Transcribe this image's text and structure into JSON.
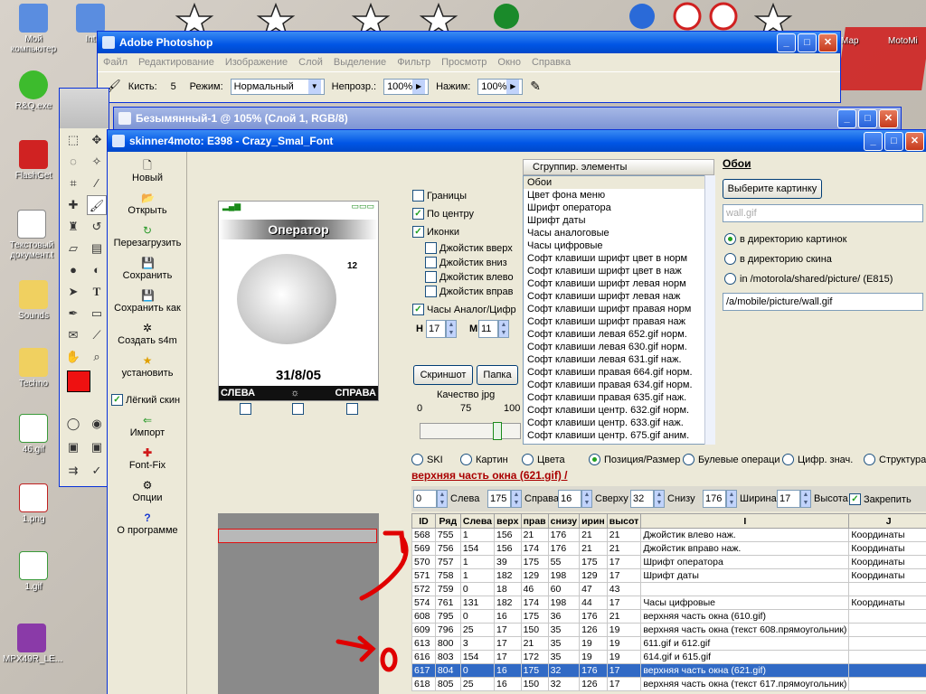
{
  "desktop": {
    "icons": [
      {
        "label": "Мой компьютер"
      },
      {
        "label": "R&Q.exe"
      },
      {
        "label": "FlashGet"
      },
      {
        "label": "Текстовый документ.t"
      },
      {
        "label": "Sounds"
      },
      {
        "label": "Techno"
      },
      {
        "label": "46.gif"
      },
      {
        "label": "1.png"
      },
      {
        "label": "1.gif"
      },
      {
        "label": "MPX49R_LE..."
      }
    ],
    "partial_labels": {
      "top_int": "Int",
      "right_mar": "Мар",
      "right_moto": "MotoMi"
    }
  },
  "photoshop": {
    "title": "Adobe Photoshop",
    "menu": [
      "Файл",
      "Редактирование",
      "Изображение",
      "Слой",
      "Выделение",
      "Фильтр",
      "Просмотр",
      "Окно",
      "Справка"
    ],
    "options": {
      "brush_label": "Кисть:",
      "brush_size": "5",
      "mode_label": "Режим:",
      "mode_value": "Нормальный",
      "opacity_label": "Непрозр.:",
      "opacity_value": "100%",
      "pressure_label": "Нажим:",
      "pressure_value": "100%"
    },
    "doc_title": "Безымянный-1 @ 105% (Слой 1, RGB/8)"
  },
  "skinner": {
    "title": "skinner4moto: E398 - Crazy_Smal_Font",
    "left_buttons": [
      {
        "label": "Новый"
      },
      {
        "label": "Открыть"
      },
      {
        "label": "Перезагрузить"
      },
      {
        "label": "Сохранить"
      },
      {
        "label": "Сохранить как"
      },
      {
        "label": "Создать s4m"
      },
      {
        "label": "установить"
      },
      {
        "label": "Лёгкий скин"
      },
      {
        "label": "Импорт"
      },
      {
        "label": "Font-Fix"
      },
      {
        "label": "Опции"
      },
      {
        "label": "О программе"
      }
    ],
    "phone": {
      "operator": "Оператор",
      "date": "31/8/05",
      "soft_left": "СЛЕВА",
      "soft_center": "☼",
      "soft_right": "СПРАВА",
      "clock_digits": "12"
    },
    "options": {
      "borders": "Границы",
      "center": "По центру",
      "icons": "Иконки",
      "joy_up": "Джойстик вверх",
      "joy_down": "Джойстик вниз",
      "joy_left": "Джойстик влево",
      "joy_right": "Джойстик вправ",
      "clock": "Часы Аналог/Цифр",
      "h_label": "Н",
      "h_value": "17",
      "m_label": "М",
      "m_value": "11",
      "screenshot": "Скриншот",
      "folder": "Папка",
      "jpg_quality": "Качество jpg",
      "q0": "0",
      "q75": "75",
      "q100": "100",
      "quality_value": 0.8
    },
    "group_title": "Сгруппир. элементы",
    "group_items": [
      "Обои",
      "Цвет фона меню",
      "Шрифт оператора",
      "Шрифт даты",
      "Часы аналоговые",
      "Часы цифровые",
      "Софт клавиши шрифт цвет в норм",
      "Софт клавиши шрифт цвет в наж",
      "Софт клавиши шрифт левая норм",
      "Софт клавиши шрифт левая наж",
      "Софт клавиши шрифт правая норм",
      "Софт клавиши шрифт правая наж",
      "Софт клавиши левая 652.gif норм.",
      "Софт клавиши левая 630.gif норм.",
      "Софт клавиши левая 631.gif наж.",
      "Софт клавиши правая 664.gif норм.",
      "Софт клавиши правая 634.gif норм.",
      "Софт клавиши правая 635.gif наж.",
      "Софт клавиши центр. 632.gif норм.",
      "Софт клавиши центр. 633.gif наж.",
      "Софт клавиши центр. 675.gif аним."
    ],
    "wallpaper": {
      "title": "Обои",
      "choose": "Выберите картинку",
      "file": "wall.gif",
      "r1": "в директорию картинок",
      "r2": "в директорию скина",
      "r3": "in /motorola/shared/picture/ (E815)",
      "path": "/a/mobile/picture/wall.gif"
    },
    "tabs": [
      "SKI",
      "Картин",
      "Цвета",
      "Позиция/Размер",
      "Булевые операци",
      "Цифр. знач.",
      "Структура"
    ],
    "section_title": "верхняя часть окна (621.gif) /",
    "pos": {
      "left_v": "0",
      "left_l": "Слева",
      "right_v": "175",
      "right_l": "Справа",
      "top_v": "16",
      "top_l": "Сверху",
      "bottom_v": "32",
      "bottom_l": "Снизу",
      "width_v": "176",
      "width_l": "Ширина",
      "height_v": "17",
      "height_l": "Высота",
      "lock": "Закрепить"
    },
    "table": {
      "headers": [
        "ID",
        "Ряд",
        "Слева",
        "верх",
        "прав",
        "снизу",
        "ирин",
        "высот",
        "I",
        "J"
      ],
      "rows": [
        [
          "568",
          "755",
          "1",
          "156",
          "21",
          "176",
          "21",
          "21",
          "Джойстик влево наж.",
          "Координаты"
        ],
        [
          "569",
          "756",
          "154",
          "156",
          "174",
          "176",
          "21",
          "21",
          "Джойстик вправо наж.",
          "Координаты"
        ],
        [
          "570",
          "757",
          "1",
          "39",
          "175",
          "55",
          "175",
          "17",
          "Шрифт оператора",
          "Координаты"
        ],
        [
          "571",
          "758",
          "1",
          "182",
          "129",
          "198",
          "129",
          "17",
          "Шрифт даты",
          "Координаты"
        ],
        [
          "572",
          "759",
          "0",
          "18",
          "46",
          "60",
          "47",
          "43",
          "",
          ""
        ],
        [
          "574",
          "761",
          "131",
          "182",
          "174",
          "198",
          "44",
          "17",
          "Часы цифровые",
          "Координаты"
        ],
        [
          "608",
          "795",
          "0",
          "16",
          "175",
          "36",
          "176",
          "21",
          "верхняя часть окна (610.gif)",
          ""
        ],
        [
          "609",
          "796",
          "25",
          "17",
          "150",
          "35",
          "126",
          "19",
          "верхняя часть окна (текст 608.прямоугольник)",
          ""
        ],
        [
          "613",
          "800",
          "3",
          "17",
          "21",
          "35",
          "19",
          "19",
          "611.gif и 612.gif",
          ""
        ],
        [
          "616",
          "803",
          "154",
          "17",
          "172",
          "35",
          "19",
          "19",
          "614.gif и 615.gif",
          ""
        ],
        [
          "617",
          "804",
          "0",
          "16",
          "175",
          "32",
          "176",
          "17",
          "верхняя часть окна (621.gif)",
          ""
        ],
        [
          "618",
          "805",
          "25",
          "16",
          "150",
          "32",
          "126",
          "17",
          "верхняя часть окна (текст 617.прямоугольник)",
          ""
        ]
      ]
    }
  }
}
